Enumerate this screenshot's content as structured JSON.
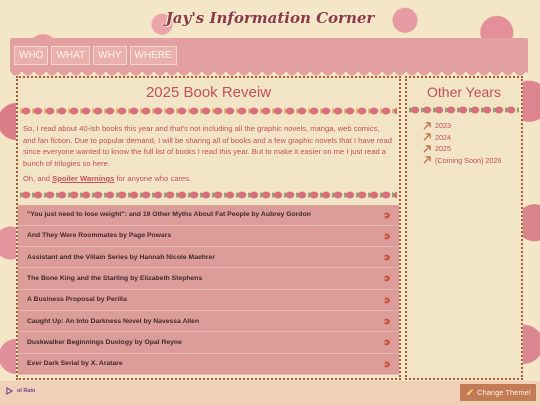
{
  "header": {
    "title": "Jay's Information Corner"
  },
  "nav": {
    "items": [
      {
        "label": "WHO"
      },
      {
        "label": "WHAT"
      },
      {
        "label": "WHY"
      },
      {
        "label": "WHERE"
      }
    ]
  },
  "main": {
    "title": "2025 Book Reveiw",
    "intro_1": "So, I read about 40-ish books this year and that's not including all the graphic novels, manga, web comics, and fan fiction. Due to popular demand, I will be sharing all of books and a few graphic novels that I have read since everyone wanted to know the full list of books I read this year. But to make it easier on me I just read a bunch of trilogies so here.",
    "intro_2_pre": "Oh, and ",
    "spoiler_link": "Spoiler Warnings",
    "intro_2_post": " for anyone who cares.",
    "books": [
      {
        "title": "\"You just need to lose weight\": and 19 Other Myths About Fat People by Aubrey Gordon"
      },
      {
        "title": "And They Were Roommates by Page Powars"
      },
      {
        "title": "Assistant and the Villain Series by Hannah Nicole Maehrer"
      },
      {
        "title": "The Bone King and the Starling by Elizabeth Stephens"
      },
      {
        "title": "A Business Proposal by Perilla"
      },
      {
        "title": "Caught Up: An Into Darkness Novel by Navessa Allen"
      },
      {
        "title": "Duskwalker Beginnings Duology by Opal Reyne"
      },
      {
        "title": "Ever Dark Serial by X. Aratare"
      }
    ]
  },
  "side": {
    "title": "Other Years",
    "years": [
      {
        "label": "2023"
      },
      {
        "label": "2024"
      },
      {
        "label": "2025"
      },
      {
        "label": "(Coming Soon) 2026"
      }
    ]
  },
  "bottom": {
    "play_label": "ol Rain",
    "theme_button": "Change Theme!"
  },
  "colors": {
    "accent": "#c44e5e",
    "nav": "#e2a0a1",
    "list": "#dc9c9a",
    "background": "#f3e7c8"
  }
}
